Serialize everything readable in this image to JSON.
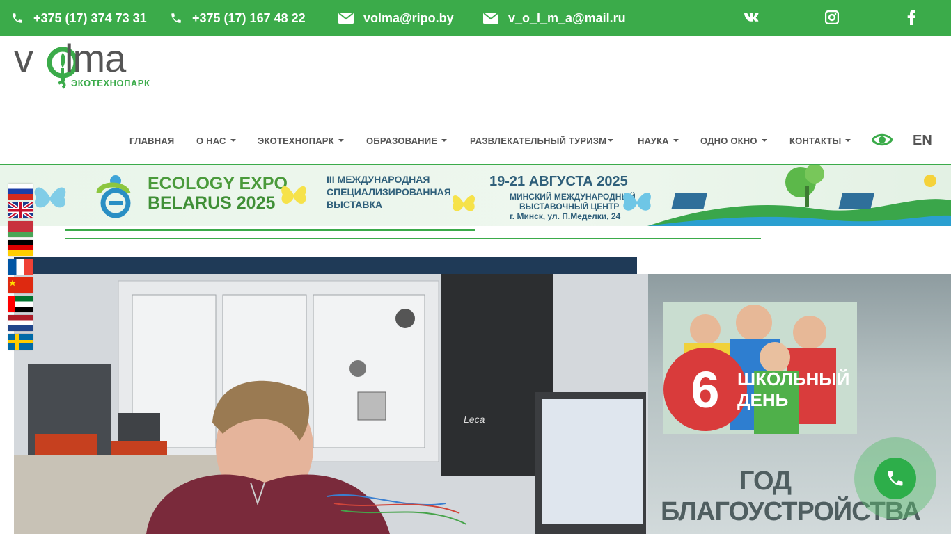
{
  "topbar": {
    "phone1": "+375 (17) 374 73 31",
    "phone2": "+375 (17) 167 48 22",
    "email1": "volma@ripo.by",
    "email2": "v_o_l_m_a@mail.ru",
    "social": [
      "vk-icon",
      "instagram-icon",
      "facebook-icon"
    ],
    "bg_color": "#3bab4a"
  },
  "logo": {
    "word": "volma",
    "subtitle": "ЭКОТЕХНОПАРК"
  },
  "nav": {
    "items": [
      {
        "label": "ГЛАВНАЯ",
        "dropdown": false
      },
      {
        "label": "О НАС",
        "dropdown": true
      },
      {
        "label": "ЭКОТЕХНОПАРК",
        "dropdown": true
      },
      {
        "label": "ОБРАЗОВАНИЕ",
        "dropdown": true
      },
      {
        "label": "РАЗВЛЕКАТЕЛЬНЫЙ ТУРИЗМ",
        "dropdown": true
      },
      {
        "label": "НАУКА",
        "dropdown": true
      },
      {
        "label": "ОДНО ОКНО",
        "dropdown": true
      },
      {
        "label": "КОНТАКТЫ",
        "dropdown": true
      }
    ],
    "lang": "EN"
  },
  "banner": {
    "expo1": "ECOLOGY EXPO",
    "expo2": "BELARUS 2025",
    "desc1": "III МЕЖДУНАРОДНАЯ",
    "desc2": "СПЕЦИАЛИЗИРОВАННАЯ",
    "desc3": "ВЫСТАВКА",
    "date": "19-21 АВГУСТА 2025",
    "venue1": "МИНСКИЙ МЕЖДУНАРОДНЫЙ",
    "venue2": "ВЫСТАВОЧНЫЙ ЦЕНТР",
    "venue3": "г. Минск, ул. П.Меделки, 24"
  },
  "side": {
    "number": "6",
    "school1": "ШКОЛЬНЫЙ",
    "school2": "ДЕНЬ",
    "god1": "ГОД",
    "god2": "БЛАГОУСТРОЙСТВА"
  },
  "flags": [
    "ru",
    "gb",
    "by",
    "de",
    "fr",
    "cn",
    "ae",
    "nl",
    "se"
  ]
}
